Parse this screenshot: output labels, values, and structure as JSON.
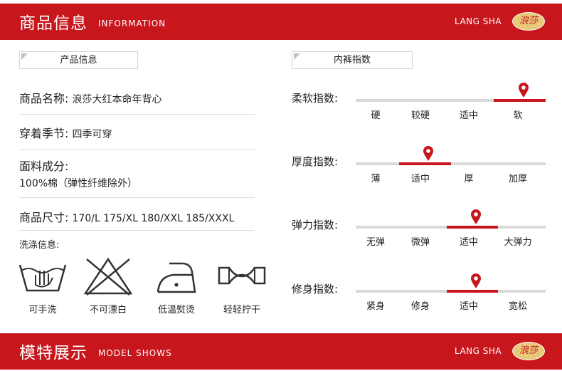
{
  "header": {
    "title_cn": "商品信息",
    "title_en": "INFORMATION",
    "brand": "LANG SHA",
    "logo_text": "浪莎"
  },
  "product": {
    "box_label": "产品信息",
    "name_label": "商品名称:",
    "name_value": "浪莎大红本命年背心",
    "season_label": "穿着季节:",
    "season_value": "四季可穿",
    "material_label": "面料成分:",
    "material_value": "100%棉（弹性纤维除外）",
    "size_label": "商品尺寸:",
    "size_value": "170/L 175/XL 180/XXL 185/XXXL",
    "care_label": "洗涤信息:",
    "care_items": [
      {
        "icon": "hand-wash-icon",
        "label": "可手洗"
      },
      {
        "icon": "no-bleach-icon",
        "label": "不可漂白"
      },
      {
        "icon": "low-temp-iron-icon",
        "label": "低温熨烫"
      },
      {
        "icon": "gentle-wring-icon",
        "label": "轻轻拧干"
      }
    ]
  },
  "indices": {
    "box_label": "内裤指数",
    "items": [
      {
        "label": "柔软指数:",
        "options": [
          "硬",
          "较硬",
          "适中",
          "软"
        ],
        "selected": 3
      },
      {
        "label": "厚度指数:",
        "options": [
          "薄",
          "适中",
          "厚",
          "加厚"
        ],
        "selected": 1
      },
      {
        "label": "弹力指数:",
        "options": [
          "无弹",
          "微弹",
          "适中",
          "大弹力"
        ],
        "selected": 2
      },
      {
        "label": "修身指数:",
        "options": [
          "紧身",
          "修身",
          "适中",
          "宽松"
        ],
        "selected": 2
      }
    ]
  },
  "footer": {
    "title_cn": "模特展示",
    "title_en": "MODEL SHOWS",
    "brand": "LANG SHA",
    "logo_text": "浪莎"
  },
  "colors": {
    "brand_red": "#c8161d",
    "track_gray": "#d9d9d9"
  }
}
